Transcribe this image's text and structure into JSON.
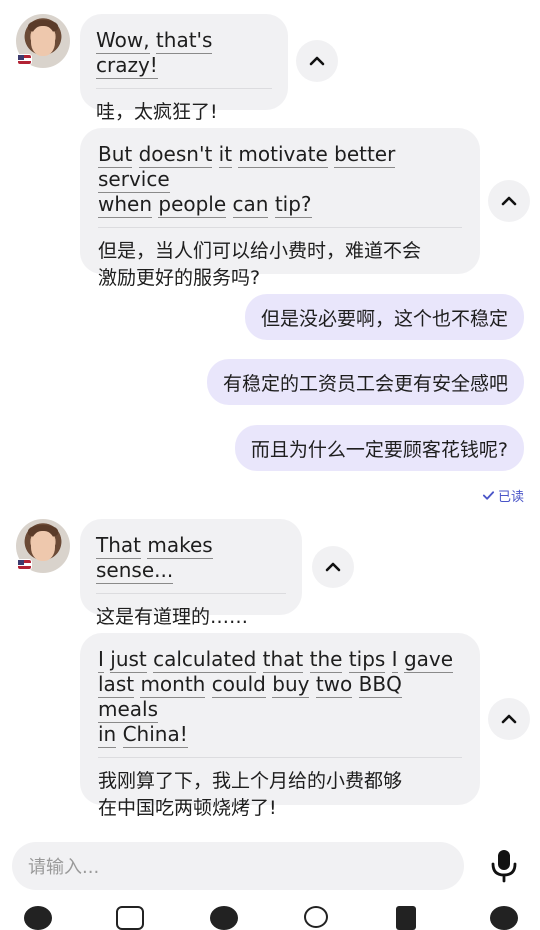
{
  "messages": [
    {
      "en_words": [
        "Wow,",
        "that's",
        "crazy!"
      ],
      "zh": "哇，太疯狂了!"
    },
    {
      "en_lines": [
        [
          "But",
          "doesn't",
          "it",
          "motivate",
          "better",
          "service"
        ],
        [
          "when",
          "people",
          "can",
          "tip?"
        ]
      ],
      "zh_lines": [
        "但是，当人们可以给小费时，难道不会",
        "激励更好的服务吗?"
      ]
    },
    {
      "en_words": [
        "That",
        "makes",
        "sense..."
      ],
      "zh": "这是有道理的……"
    },
    {
      "en_lines": [
        [
          "I",
          "just",
          "calculated",
          "that",
          "the",
          "tips",
          "I",
          "gave"
        ],
        [
          "last",
          "month",
          "could",
          "buy",
          "two",
          "BBQ",
          "meals"
        ],
        [
          "in",
          "China!"
        ]
      ],
      "zh_lines": [
        "我刚算了下，我上个月给的小费都够",
        "在中国吃两顿烧烤了!"
      ]
    }
  ],
  "my_messages": [
    "但是没必要啊，这个也不稳定",
    "有稳定的工资员工会更有安全感吧",
    "而且为什么一定要顾客花钱呢?"
  ],
  "read_status": "已读",
  "input": {
    "placeholder": "请输入..."
  },
  "icons": {
    "toggle": "chevron-up-icon",
    "mic": "microphone-icon",
    "read": "checkmark-icon",
    "flag": "us-flag-icon"
  },
  "colors": {
    "incoming_bubble": "#f1f1f3",
    "outgoing_bubble": "#e9e6fb",
    "read_status": "#4a55c8"
  }
}
